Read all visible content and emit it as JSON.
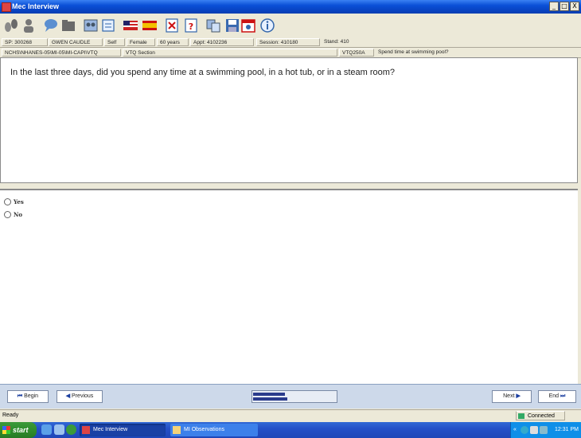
{
  "window": {
    "title": "Mec Interview",
    "controls": {
      "minimize": "_",
      "maximize": "□",
      "close": "X"
    }
  },
  "toolbar": {
    "icons": [
      "footprints-icon",
      "person-icon",
      "speech-bubble-icon",
      "folder-icon",
      "people-icon",
      "notepad-icon",
      "us-flag-icon",
      "spain-flag-icon",
      "checklist-x-icon",
      "help-book-icon",
      "copy-icon",
      "save-icon",
      "calendar-icon",
      "info-icon"
    ]
  },
  "status1": {
    "sp": "SP: 300268",
    "name": "GWEN CAUDLE",
    "role": "Self",
    "gender": "Female",
    "age": "60 years",
    "appt": "Appt: 4102236",
    "session": "Session: 410180",
    "stand": "Stand: 410"
  },
  "status2": {
    "path": "NCHS\\NHANES-05\\MI-05\\MI-CAPI\\VTQ",
    "section": "VTQ Section",
    "code": "VTQ250A",
    "short": "Spend time at swimming pool?"
  },
  "question": {
    "text": "In the last three days, did you spend any time at a swimming pool, in a hot tub, or in a steam room?"
  },
  "answers": [
    {
      "label": "Yes"
    },
    {
      "label": "No"
    }
  ],
  "nav": {
    "begin": "Begin",
    "previous": "Previous",
    "next": "Next",
    "end": "End",
    "begin_icon": "⏮",
    "previous_icon": "◀",
    "next_icon": "▶",
    "end_icon": "⏭"
  },
  "statusbar": {
    "ready": "Ready",
    "connected": "Connected"
  },
  "taskbar": {
    "start": "start",
    "tasks": [
      "Mec Interview",
      "MI Observations"
    ],
    "clock": "12:31 PM",
    "tray_chevron": "«"
  },
  "colors": {
    "titlebar": "#0a4fd7",
    "navbar": "#cdd9ea",
    "progress": "#2a3b8c"
  }
}
